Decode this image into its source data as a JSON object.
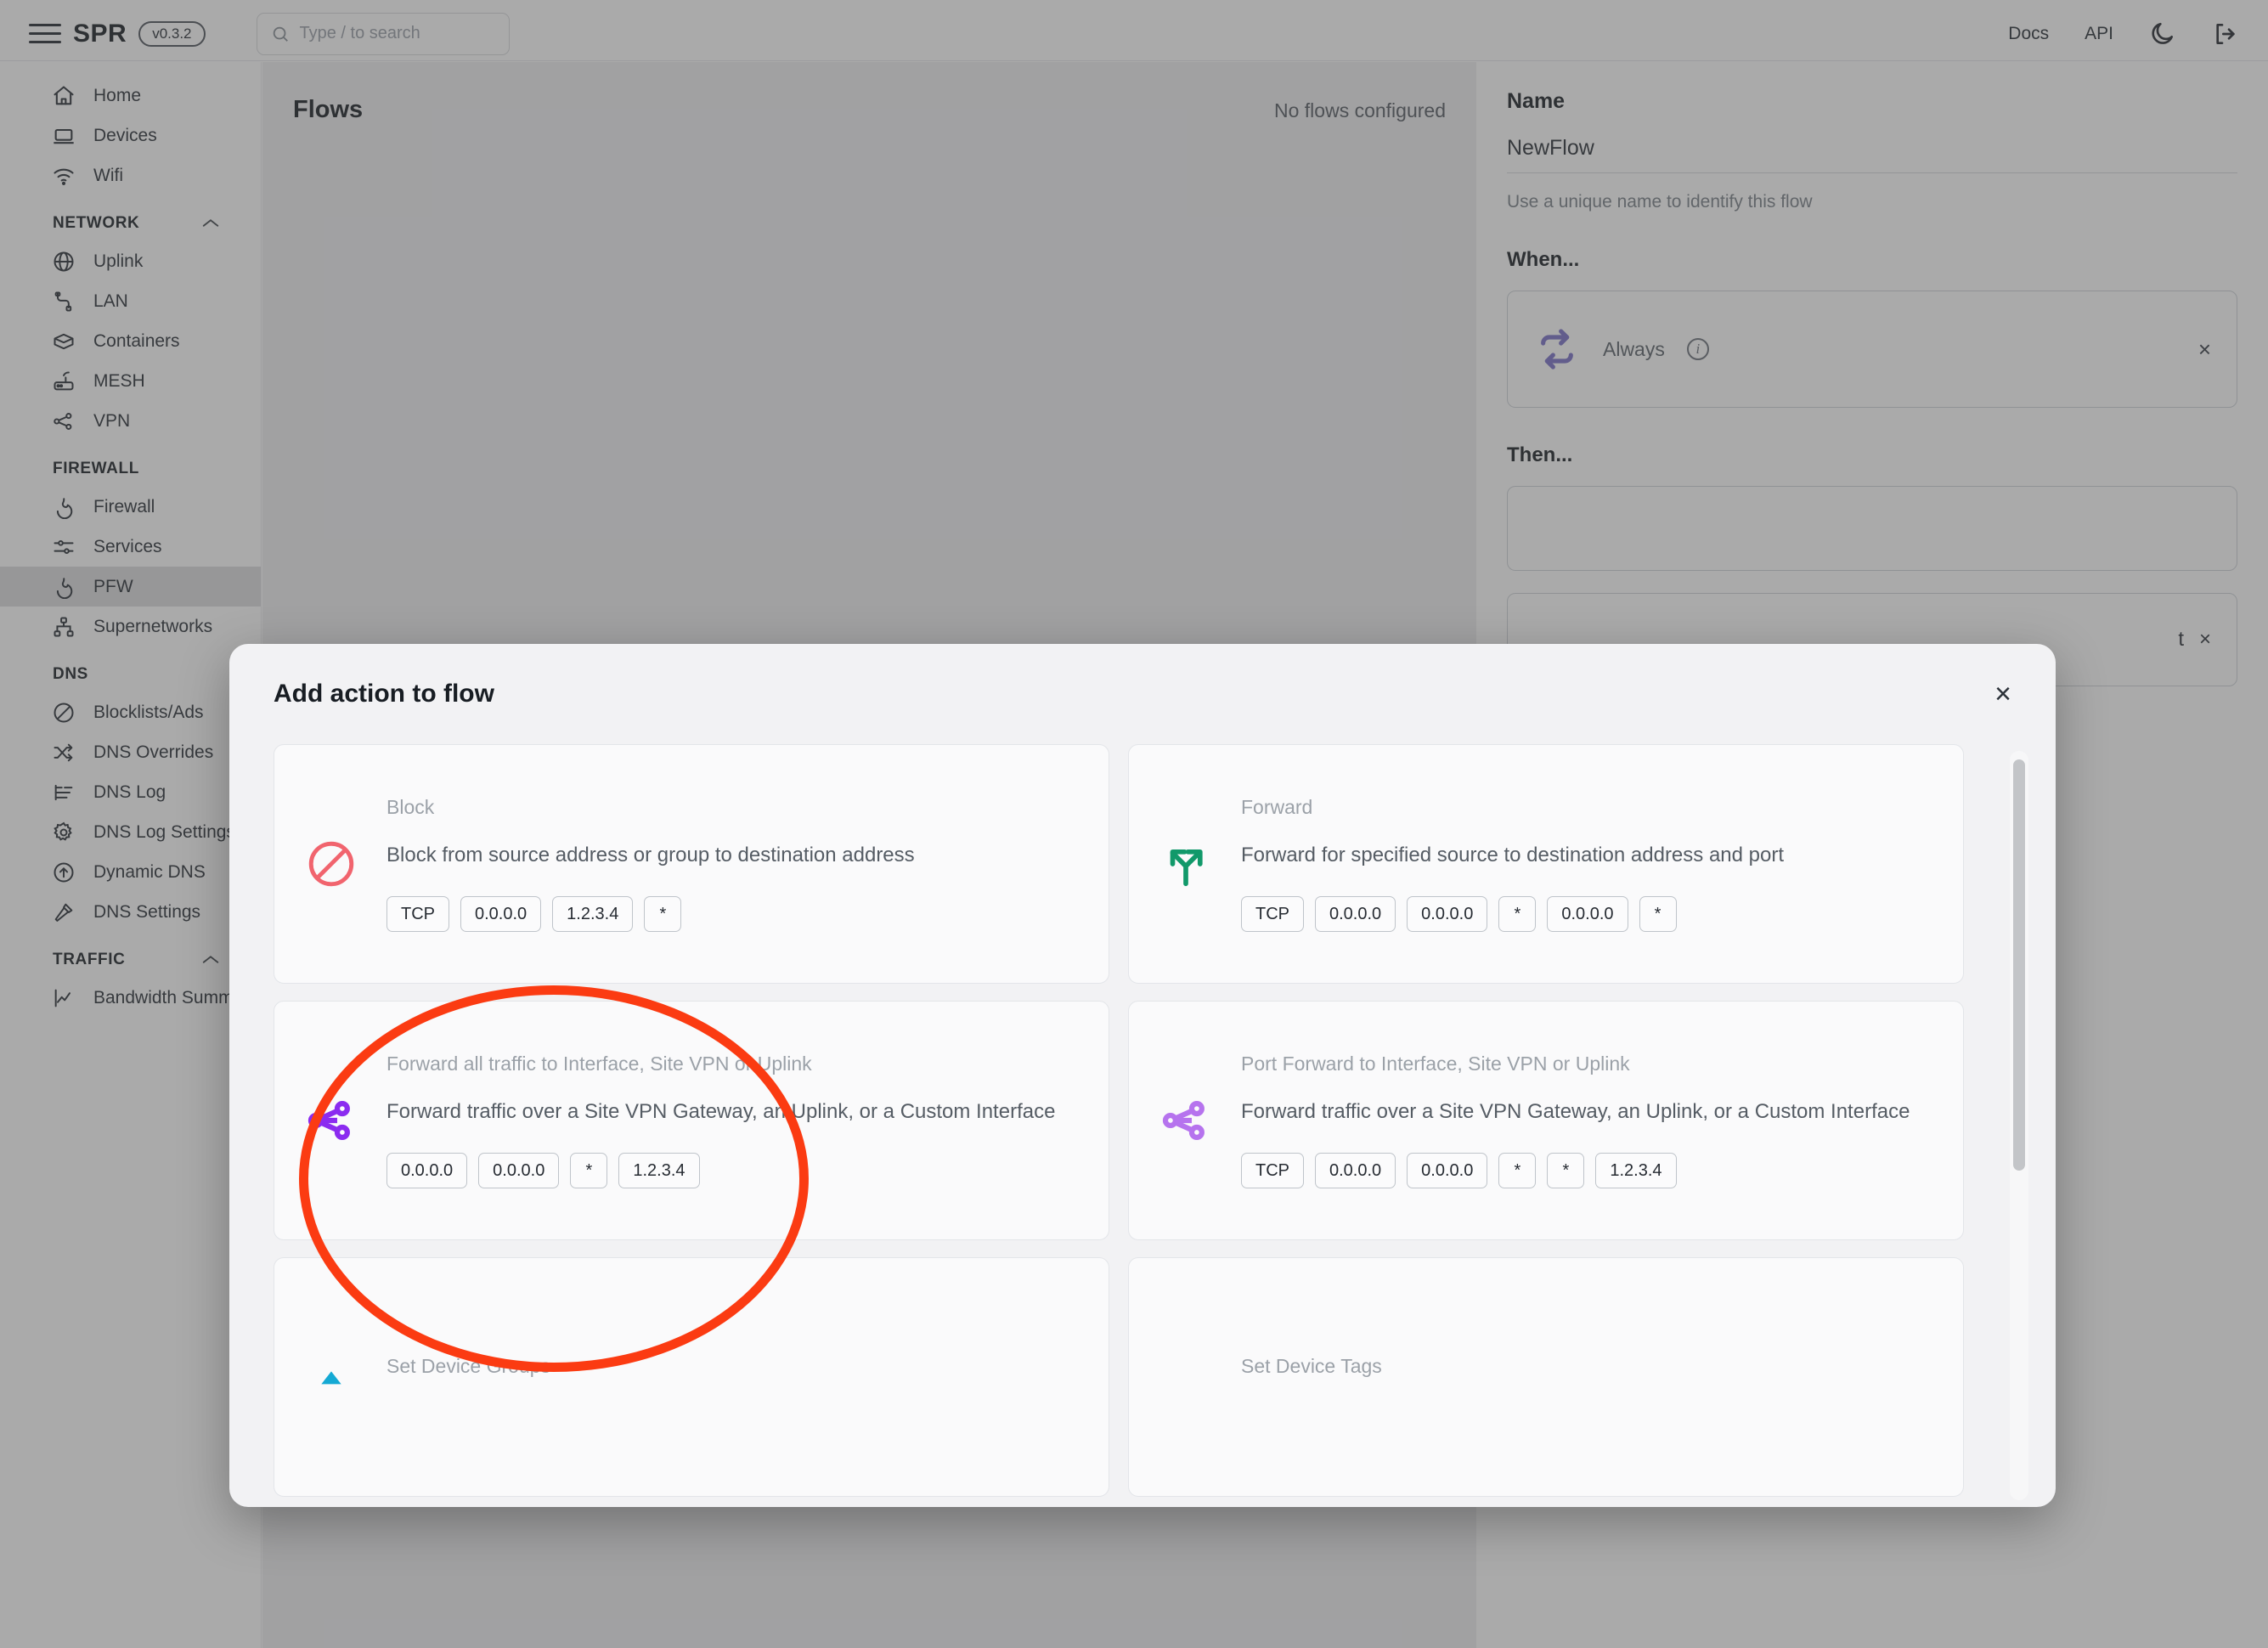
{
  "header": {
    "brand": "SPR",
    "version": "v0.3.2",
    "search_placeholder": "Type / to search",
    "docs_label": "Docs",
    "api_label": "API"
  },
  "sidebar": {
    "items": [
      {
        "label": "Home",
        "icon": "home-icon",
        "type": "item"
      },
      {
        "label": "Devices",
        "icon": "laptop-icon",
        "type": "item"
      },
      {
        "label": "Wifi",
        "icon": "wifi-icon",
        "type": "item"
      },
      {
        "label": "NETWORK",
        "icon": "chevron-up-icon",
        "type": "section"
      },
      {
        "label": "Uplink",
        "icon": "globe-icon",
        "type": "item"
      },
      {
        "label": "LAN",
        "icon": "plug-icon",
        "type": "item"
      },
      {
        "label": "Containers",
        "icon": "box-icon",
        "type": "item"
      },
      {
        "label": "MESH",
        "icon": "router-icon",
        "type": "item"
      },
      {
        "label": "VPN",
        "icon": "share-nodes-icon",
        "type": "item"
      },
      {
        "label": "FIREWALL",
        "icon": "",
        "type": "section"
      },
      {
        "label": "Firewall",
        "icon": "flame-icon",
        "type": "item"
      },
      {
        "label": "Services",
        "icon": "sliders-icon",
        "type": "item"
      },
      {
        "label": "PFW",
        "icon": "flame-icon",
        "type": "item",
        "active": true
      },
      {
        "label": "Supernetworks",
        "icon": "sitemap-icon",
        "type": "item"
      },
      {
        "label": "DNS",
        "icon": "",
        "type": "section"
      },
      {
        "label": "Blocklists/Ads",
        "icon": "ban-icon",
        "type": "item"
      },
      {
        "label": "DNS Overrides",
        "icon": "shuffle-icon",
        "type": "item"
      },
      {
        "label": "DNS Log",
        "icon": "log-list-icon",
        "type": "item"
      },
      {
        "label": "DNS Log Settings",
        "icon": "gear-icon",
        "type": "item"
      },
      {
        "label": "Dynamic DNS",
        "icon": "arrow-up-circle-icon",
        "type": "item"
      },
      {
        "label": "DNS Settings",
        "icon": "hammer-icon",
        "type": "item"
      },
      {
        "label": "TRAFFIC",
        "icon": "chevron-up-icon",
        "type": "section"
      },
      {
        "label": "Bandwidth Summary",
        "icon": "chart-line-icon",
        "type": "item"
      }
    ]
  },
  "main": {
    "flows_title": "Flows",
    "flows_empty": "No flows configured"
  },
  "right_panel": {
    "name_label": "Name",
    "name_value": "NewFlow",
    "name_hint": "Use a unique name to identify this flow",
    "when_label": "When...",
    "when_card_label": "Always",
    "when_card_icon": "repeat-icon",
    "when_close": "×",
    "then_label": "Then...",
    "trailing_fragment": "t"
  },
  "modal": {
    "title": "Add action to flow",
    "close": "×",
    "cards": [
      {
        "title": "Block",
        "description": "Block from source address or group to destination address",
        "icon": "ban-icon",
        "icon_color": "#f1646e",
        "tags": [
          "TCP",
          "0.0.0.0",
          "1.2.3.4",
          "*"
        ]
      },
      {
        "title": "Forward",
        "description": "Forward for specified source to destination address and port",
        "icon": "fork-arrows-icon",
        "icon_color": "#11996a",
        "tags": [
          "TCP",
          "0.0.0.0",
          "0.0.0.0",
          "*",
          "0.0.0.0",
          "*"
        ]
      },
      {
        "title": "Forward all traffic to Interface, Site VPN or Uplink",
        "description": "Forward traffic over a Site VPN Gateway, an Uplink, or a Custom Interface",
        "icon": "share-nodes-icon",
        "icon_color": "#8b2bf0",
        "tags": [
          "0.0.0.0",
          "0.0.0.0",
          "*",
          "1.2.3.4"
        ]
      },
      {
        "title": "Port Forward to Interface, Site VPN or Uplink",
        "description": "Forward traffic over a Site VPN Gateway, an Uplink, or a Custom Interface",
        "icon": "share-nodes-icon",
        "icon_color": "#b673ee",
        "tags": [
          "TCP",
          "0.0.0.0",
          "0.0.0.0",
          "*",
          "*",
          "1.2.3.4"
        ]
      },
      {
        "title": "Set Device Groups",
        "description": "",
        "icon": "triangle-icon",
        "icon_color": "#14a9d4",
        "tags": []
      },
      {
        "title": "Set Device Tags",
        "description": "",
        "icon": "",
        "icon_color": "#14a9d4",
        "tags": []
      }
    ]
  },
  "annotation": {
    "shape": "ellipse",
    "color": "#fb3b12",
    "targets": "forward-all-traffic-card"
  }
}
